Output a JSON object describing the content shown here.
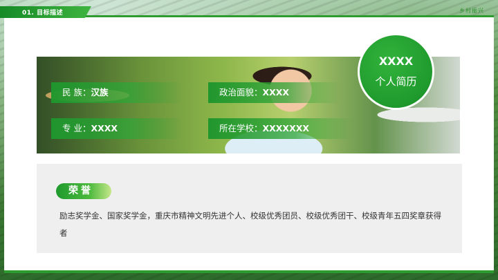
{
  "header": {
    "section_label": "01. 目标描述",
    "top_right": "乡村振兴"
  },
  "profile": {
    "badge_title": "XXXX",
    "badge_subtitle": "个人简历",
    "fields": [
      {
        "label": "民  族：",
        "value": "汉族"
      },
      {
        "label": "政治面貌：",
        "value": "XXXX"
      },
      {
        "label": "专  业：",
        "value": "XXXX"
      },
      {
        "label": "所在学校：",
        "value": "XXXXXXX"
      }
    ]
  },
  "honors": {
    "title": "荣誉",
    "text": "励志奖学金、国家奖学金，重庆市精神文明先进个人、校级优秀团员、校级优秀团干、校级青年五四奖章获得者"
  },
  "colors": {
    "accent": "#1f9a2d",
    "panel": "#efefef",
    "text": "#333333"
  }
}
